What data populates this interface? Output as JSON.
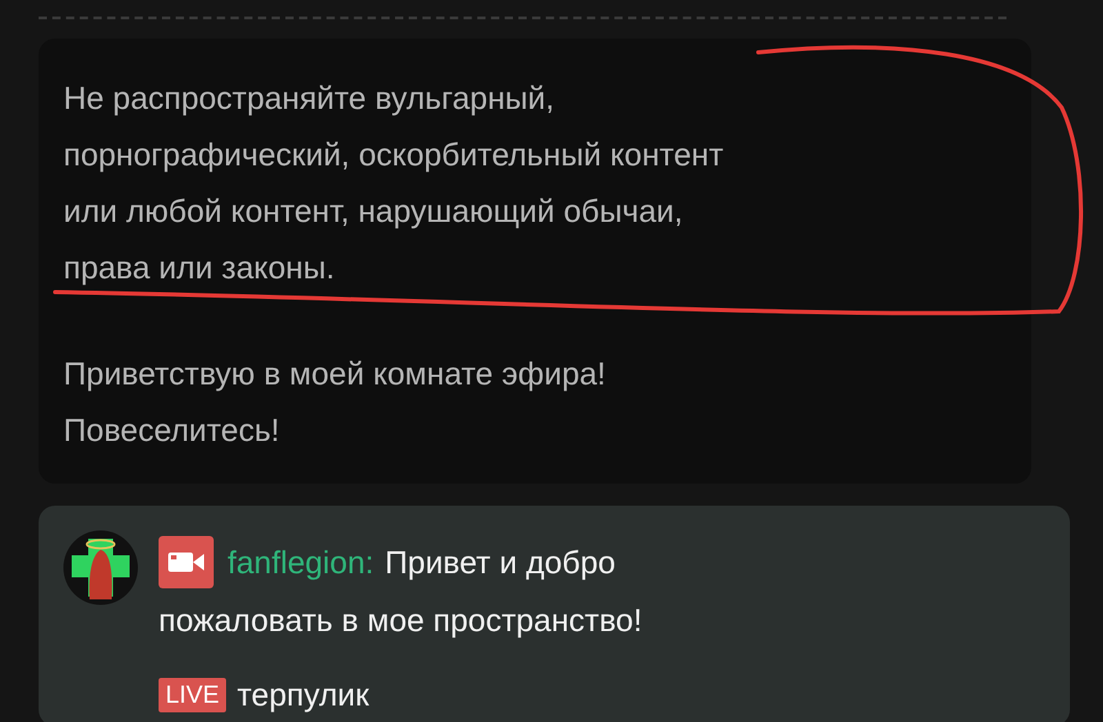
{
  "notice": {
    "paragraphs": [
      {
        "lines": [
          "Не распространяйте вульгарный,",
          "порнографический, оскорбительный контент",
          "или любой контент, нарушающий обычаи,",
          "права или законы."
        ]
      },
      {
        "lines": [
          "Приветствую в моей комнате эфира!",
          "Повеселитесь!"
        ]
      }
    ]
  },
  "messages": [
    {
      "kind": "chat",
      "username": "fanflegion:",
      "lines": [
        "Привет и добро",
        "пожаловать в мое пространство!"
      ]
    },
    {
      "kind": "live",
      "badge": "LIVE",
      "text": "терпулик"
    }
  ]
}
